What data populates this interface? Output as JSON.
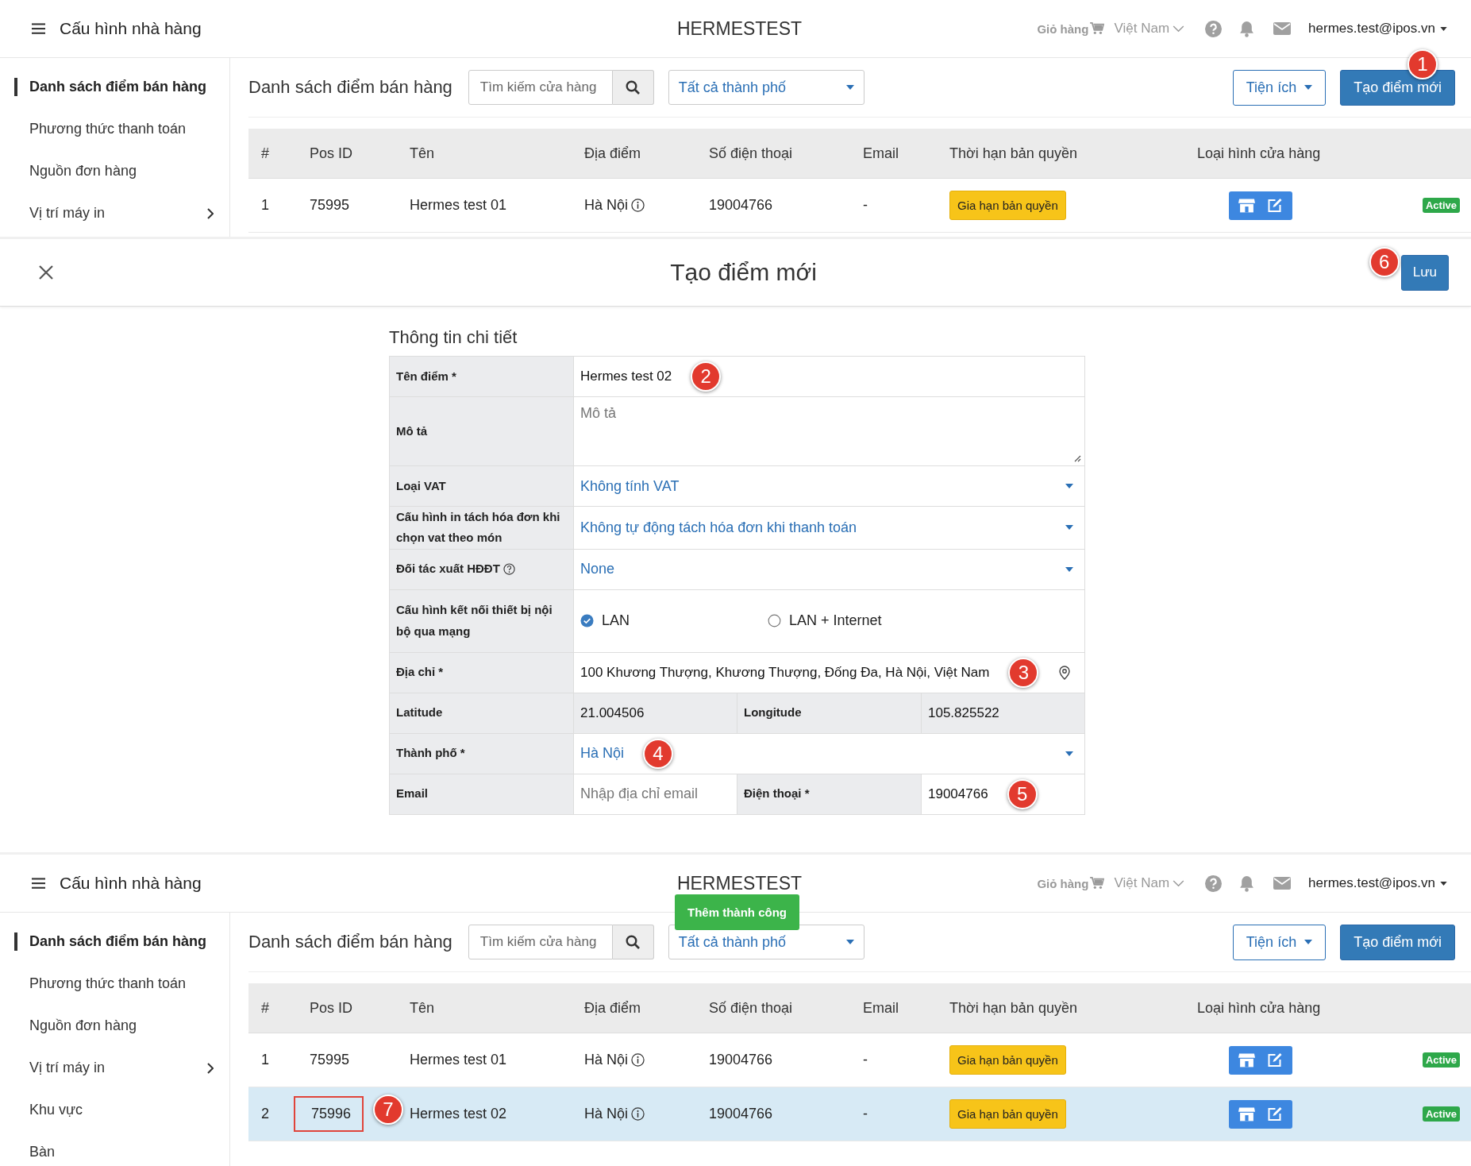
{
  "screens": [
    {
      "kind": "list",
      "header": {
        "title": "Cấu hình nhà hàng",
        "brand": "HERMESTEST",
        "cart": "Giỏ hàng",
        "language": "Việt Nam",
        "user": "hermes.test@ipos.vn"
      },
      "sidebar": [
        {
          "label": "Danh sách điểm bán hàng",
          "selected": true,
          "submenu": false
        },
        {
          "label": "Phương thức thanh toán",
          "selected": false,
          "submenu": false
        },
        {
          "label": "Nguồn đơn hàng",
          "selected": false,
          "submenu": false
        },
        {
          "label": "Vị trí máy in",
          "selected": false,
          "submenu": true
        }
      ],
      "toolbar": {
        "title": "Danh sách điểm bán hàng",
        "search_placeholder": "Tìm kiếm cửa hàng",
        "city": "Tất cả thành phố",
        "utilities": "Tiện ích",
        "create": "Tạo điểm mới",
        "create_callout": "1"
      },
      "table": {
        "columns": [
          "#",
          "Pos ID",
          "Tên",
          "Địa điểm",
          "Số điện thoại",
          "Email",
          "Thời hạn bản quyền",
          "Loại hình cửa hàng"
        ],
        "rows": [
          {
            "index": "1",
            "pos_id": "75995",
            "name": "Hermes test 01",
            "location": "Hà Nội",
            "phone": "19004766",
            "email": "-",
            "license": "Gia hạn bản quyền",
            "status": "Active",
            "selected": false
          }
        ]
      }
    },
    {
      "kind": "form",
      "title": "Tạo điểm mới",
      "save": "Lưu",
      "save_callout": "6",
      "section": "Thông tin chi tiết",
      "fields": [
        {
          "kind": "input",
          "label": "Tên điểm *",
          "value": "Hermes test 02",
          "callout": "2"
        },
        {
          "kind": "textarea",
          "label": "Mô tả",
          "placeholder": "Mô tả"
        },
        {
          "kind": "select",
          "label": "Loại VAT",
          "value": "Không tính VAT"
        },
        {
          "kind": "select",
          "label": "Cấu hình in tách hóa đơn khi chọn vat theo món",
          "value": "Không tự động tách hóa đơn khi thanh toán"
        },
        {
          "kind": "select",
          "label": "Đối tác xuất HĐĐT",
          "help": true,
          "value": "None"
        },
        {
          "kind": "radio",
          "label": "Cấu hình kết nối thiết bị nội bộ qua mạng",
          "options": [
            {
              "label": "LAN",
              "selected": true
            },
            {
              "label": "LAN + Internet",
              "selected": false
            }
          ]
        },
        {
          "kind": "input",
          "label": "Địa chỉ *",
          "value": "100 Khương Thượng, Khương Thượng, Đống Đa, Hà Nội, Việt Nam",
          "callout": "3",
          "pin": true
        },
        {
          "kind": "pair",
          "cells": [
            {
              "label": "Latitude",
              "value": "21.004506",
              "readonly": true
            },
            {
              "label": "Longitude",
              "value": "105.825522",
              "readonly": true
            }
          ]
        },
        {
          "kind": "select",
          "label": "Thành phố *",
          "value": "Hà Nội",
          "callout": "4"
        },
        {
          "kind": "pair",
          "cells": [
            {
              "label": "Email",
              "placeholder": "Nhập địa chỉ email",
              "readonly": false
            },
            {
              "label": "Điện thoại *",
              "value": "19004766",
              "readonly": false,
              "callout": "5"
            }
          ]
        }
      ]
    },
    {
      "kind": "list",
      "header": {
        "title": "Cấu hình nhà hàng",
        "brand": "HERMESTEST",
        "cart": "Giỏ hàng",
        "language": "Việt Nam",
        "user": "hermes.test@ipos.vn"
      },
      "toast": "Thêm thành công",
      "sidebar": [
        {
          "label": "Danh sách điểm bán hàng",
          "selected": true,
          "submenu": false
        },
        {
          "label": "Phương thức thanh toán",
          "selected": false,
          "submenu": false
        },
        {
          "label": "Nguồn đơn hàng",
          "selected": false,
          "submenu": false
        },
        {
          "label": "Vị trí máy in",
          "selected": false,
          "submenu": true
        },
        {
          "label": "Khu vực",
          "selected": false,
          "submenu": false
        },
        {
          "label": "Bàn",
          "selected": false,
          "submenu": false
        }
      ],
      "toolbar": {
        "title": "Danh sách điểm bán hàng",
        "search_placeholder": "Tìm kiếm cửa hàng",
        "city": "Tất cả thành phố",
        "utilities": "Tiện ích",
        "create": "Tạo điểm mới"
      },
      "table": {
        "columns": [
          "#",
          "Pos ID",
          "Tên",
          "Địa điểm",
          "Số điện thoại",
          "Email",
          "Thời hạn bản quyền",
          "Loại hình cửa hàng"
        ],
        "rows": [
          {
            "index": "1",
            "pos_id": "75995",
            "name": "Hermes test 01",
            "location": "Hà Nội",
            "phone": "19004766",
            "email": "-",
            "license": "Gia hạn bản quyền",
            "status": "Active",
            "selected": false
          },
          {
            "index": "2",
            "pos_id": "75996",
            "pos_callout": "7",
            "name": "Hermes test 02",
            "location": "Hà Nội",
            "phone": "19004766",
            "email": "-",
            "license": "Gia hạn bản quyền",
            "status": "Active",
            "selected": true
          }
        ]
      }
    }
  ]
}
